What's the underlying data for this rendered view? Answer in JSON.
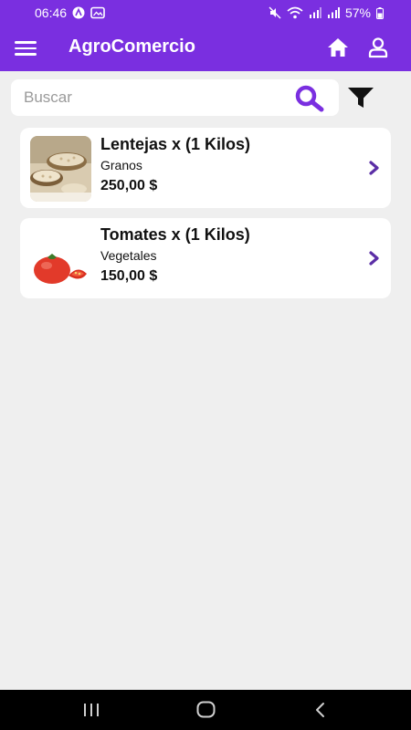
{
  "status_bar": {
    "time": "06:46",
    "battery": "57%"
  },
  "app_bar": {
    "title": "AgroComercio",
    "menu_icon": "hamburger-menu-icon",
    "home_icon": "home-icon",
    "profile_icon": "user-icon"
  },
  "search": {
    "placeholder": "Buscar",
    "value": "",
    "search_icon": "search-icon",
    "filter_icon": "filter-icon"
  },
  "products": [
    {
      "name": "Lentejas x (1 Kilos)",
      "category": "Granos",
      "price": "250,00 $"
    },
    {
      "name": "Tomates x (1 Kilos)",
      "category": "Vegetales",
      "price": "150,00 $"
    }
  ],
  "colors": {
    "primary": "#7a2fe0",
    "background": "#efefef",
    "card": "#ffffff",
    "chevron": "#5b2ea6"
  }
}
